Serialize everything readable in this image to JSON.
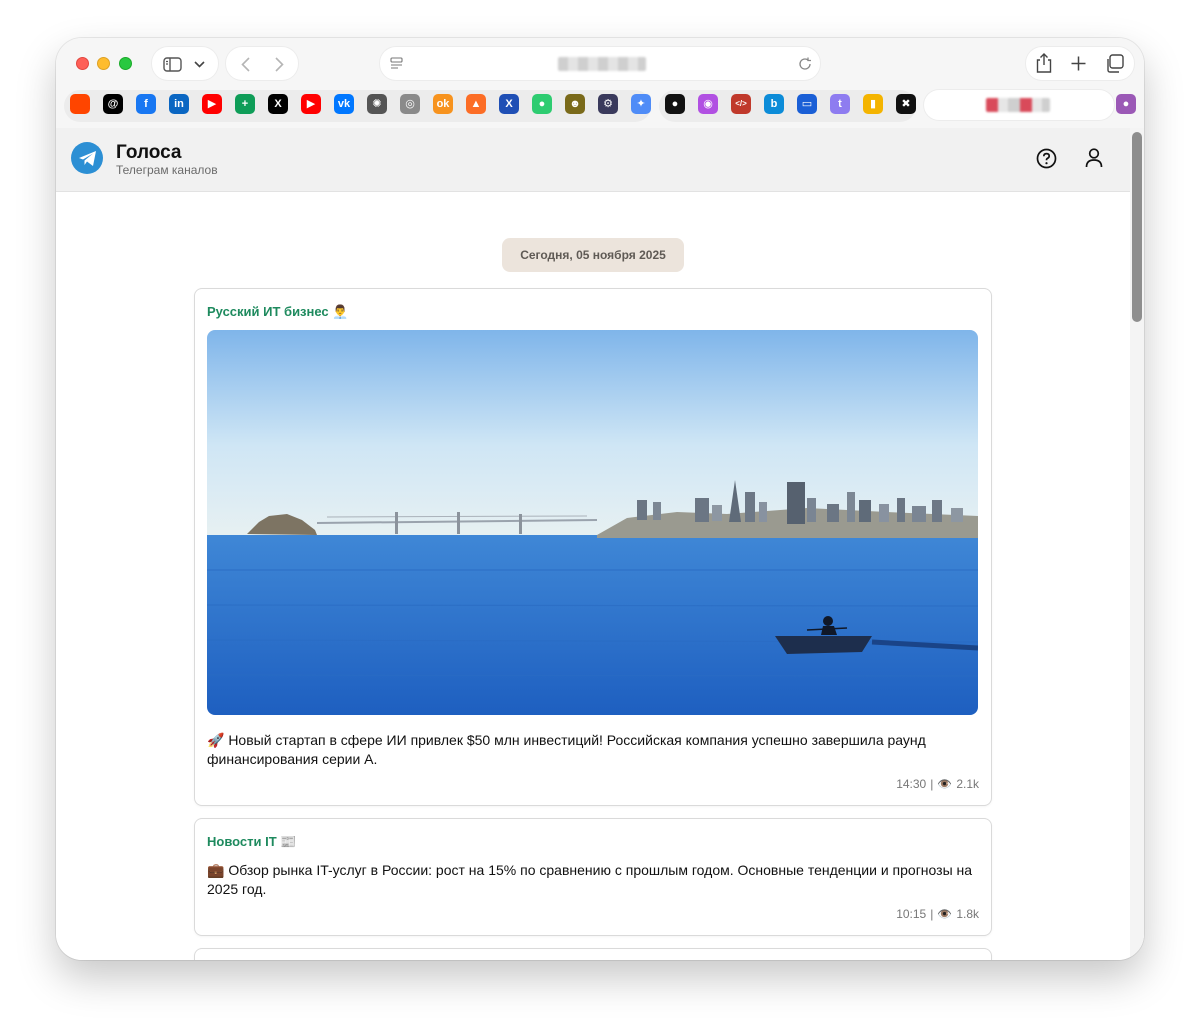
{
  "app": {
    "title": "Голоса",
    "subtitle": "Телеграм каналов"
  },
  "feed": {
    "date_label": "Сегодня, 05 ноября 2025",
    "posts": [
      {
        "channel": "Русский ИТ бизнес 👨‍💼",
        "has_image": true,
        "text": "🚀 Новый стартап в сфере ИИ привлек $50 млн инвестиций! Российская компания успешно завершила раунд финансирования серии А.",
        "time": "14:30",
        "views": "2.1k"
      },
      {
        "channel": "Новости IT 📰",
        "has_image": false,
        "text": "💼 Обзор рынка IT-услуг в России: рост на 15% по сравнению с прошлым годом. Основные тенденции и прогнозы на 2025 год.",
        "time": "10:15",
        "views": "1.8k"
      }
    ],
    "meta_separator": "|",
    "views_icon": "👁️"
  },
  "colors": {
    "channel_name": "#1e8a5e",
    "logo": "#2c8fd4",
    "date_chip_bg": "#ece4dc",
    "header_bg": "#f1f1f1"
  },
  "bookmarks": [
    {
      "name": "reddit-icon",
      "glyph": "",
      "color": "#ff4500"
    },
    {
      "name": "threads-icon",
      "glyph": "@",
      "color": "#000000"
    },
    {
      "name": "facebook-icon",
      "glyph": "f",
      "color": "#1877f2"
    },
    {
      "name": "linkedin-icon",
      "glyph": "in",
      "color": "#0a66c2"
    },
    {
      "name": "youtube-icon",
      "glyph": "▶",
      "color": "#ff0000"
    },
    {
      "name": "sheets-icon",
      "glyph": "+",
      "color": "#0f9d58"
    },
    {
      "name": "x-icon",
      "glyph": "X",
      "color": "#000000"
    },
    {
      "name": "youtube-icon",
      "glyph": "▶",
      "color": "#ff0000"
    },
    {
      "name": "vk-icon",
      "glyph": "vk",
      "color": "#0077ff"
    },
    {
      "name": "openai-icon",
      "glyph": "✺",
      "color": "#555555"
    },
    {
      "name": "compass-icon",
      "glyph": "◎",
      "color": "#8a8a8a"
    },
    {
      "name": "odnoklassniki-icon",
      "glyph": "ok",
      "color": "#f7931e"
    },
    {
      "name": "gitlab-icon",
      "glyph": "▲",
      "color": "#fc6d26"
    },
    {
      "name": "x-bold-icon",
      "glyph": "X",
      "color": "#1f4fb5"
    },
    {
      "name": "green-dot-icon",
      "glyph": "●",
      "color": "#2ecc71"
    },
    {
      "name": "face-icon",
      "glyph": "☻",
      "color": "#7a6a1a"
    },
    {
      "name": "gear-icon",
      "glyph": "⚙",
      "color": "#3a3a5c"
    },
    {
      "name": "gemini-icon",
      "glyph": "✦",
      "color": "#4f8cf7"
    },
    {
      "name": "github-icon",
      "glyph": "●",
      "color": "#111111"
    },
    {
      "name": "podcasts-icon",
      "glyph": "◉",
      "color": "#b150e2"
    },
    {
      "name": "code-icon",
      "glyph": "</>",
      "color": "#c0392b"
    },
    {
      "name": "bing-icon",
      "glyph": "b",
      "color": "#0c8cd8"
    },
    {
      "name": "window-icon",
      "glyph": "▭",
      "color": "#1a5fd6"
    },
    {
      "name": "t-icon",
      "glyph": "t",
      "color": "#8e7cf0"
    },
    {
      "name": "analytics-icon",
      "glyph": "▮",
      "color": "#f4b400"
    },
    {
      "name": "pinwheel-icon",
      "glyph": "✖",
      "color": "#111111"
    },
    {
      "name": "purple-dot-icon",
      "glyph": "●",
      "color": "#9b59b6"
    }
  ]
}
